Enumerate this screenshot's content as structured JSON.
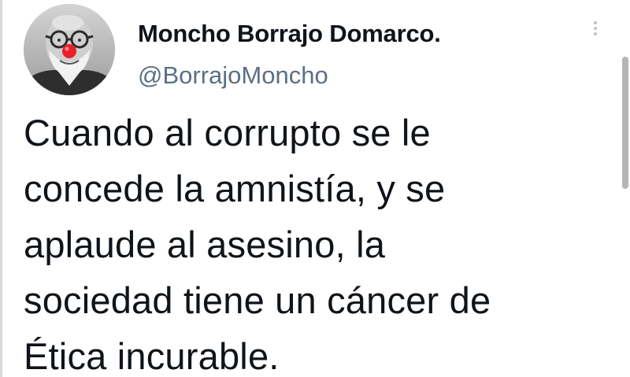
{
  "author": {
    "display_name": "Moncho Borrajo Domarco.",
    "handle": "@BorrajoMoncho",
    "avatar_icon": "avatar-clown-nose-portrait"
  },
  "tweet": {
    "lines": [
      "Cuando al corrupto se le",
      "concede la amnistía, y se",
      "aplaude al asesino, la",
      "sociedad tiene un cáncer de",
      "Ética incurable."
    ]
  },
  "icons": {
    "more": "more-vertical-icon"
  },
  "colors": {
    "text": "#0f1419",
    "handle": "#5b7083",
    "clown_nose": "#e8202a"
  }
}
